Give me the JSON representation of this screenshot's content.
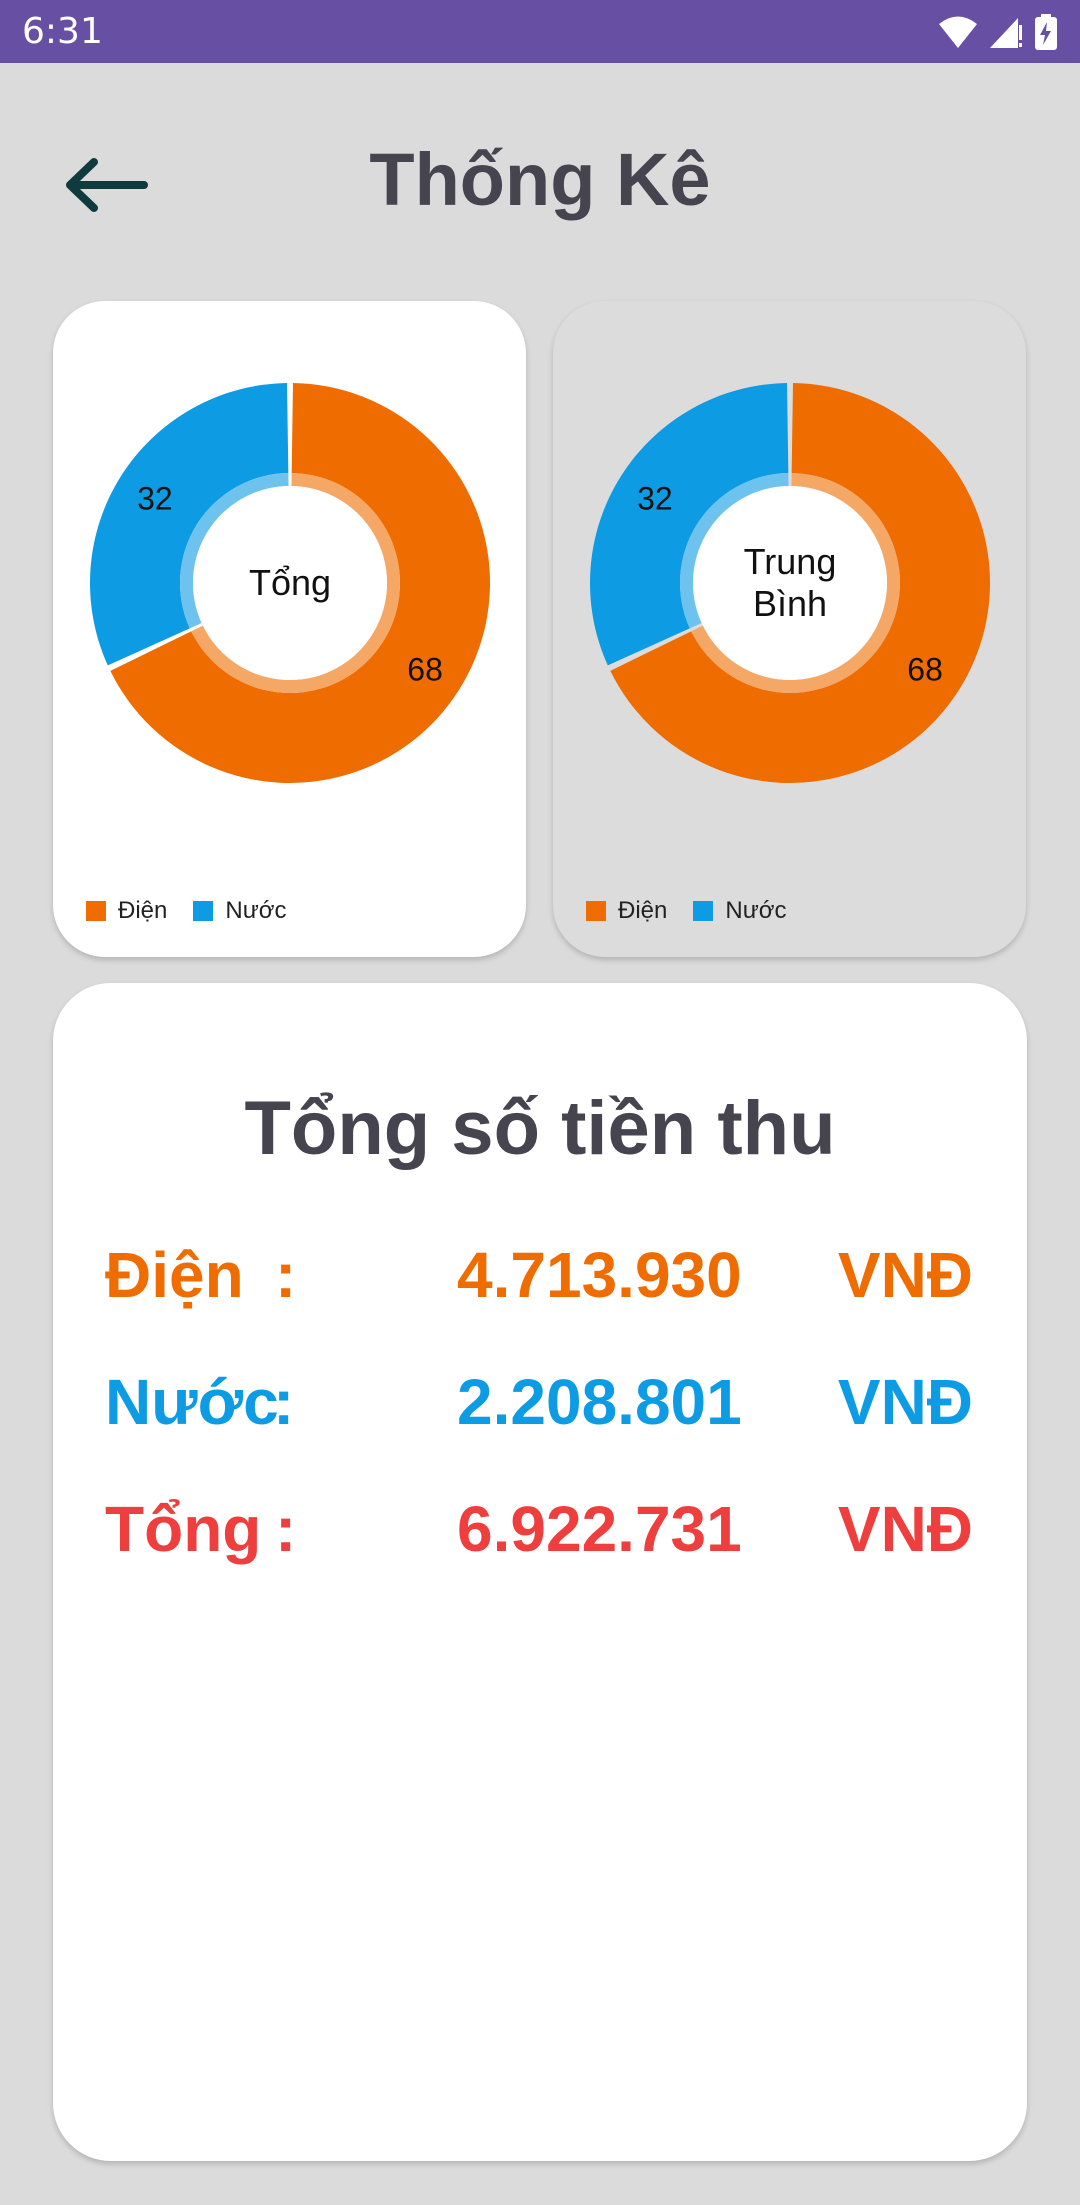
{
  "status_bar": {
    "time": "6:31",
    "icons": [
      "wifi-icon",
      "signal-icon",
      "battery-charging-icon"
    ]
  },
  "header": {
    "title": "Thống Kê",
    "back_icon": "arrow-left-icon"
  },
  "colors": {
    "status_bar": "#6750a4",
    "background": "#dbdbdb",
    "dien": "#ef6c00",
    "nuoc": "#0d9be3",
    "tong": "#ee3e3e",
    "title": "#45444f"
  },
  "chart_data": [
    {
      "type": "pie",
      "center_label": "Tổng",
      "categories": [
        "Điện",
        "Nước"
      ],
      "values": [
        68,
        32
      ],
      "colors": [
        "#ef6c00",
        "#0d9be3"
      ],
      "legend": [
        "Điện",
        "Nước"
      ],
      "legend_position": "bottom-left"
    },
    {
      "type": "pie",
      "center_label": "Trung\nBình",
      "center_lines": [
        "Trung",
        "Bình"
      ],
      "categories": [
        "Điện",
        "Nước"
      ],
      "values": [
        68,
        32
      ],
      "colors": [
        "#ef6c00",
        "#0d9be3"
      ],
      "legend": [
        "Điện",
        "Nước"
      ],
      "legend_position": "bottom-left"
    }
  ],
  "summary": {
    "title": "Tổng số tiền thu",
    "rows": [
      {
        "label": "Điện",
        "colon": ":",
        "amount": "4.713.930",
        "currency": "VNĐ"
      },
      {
        "label": "Nước",
        "colon": ":",
        "amount": "2.208.801",
        "currency": "VNĐ"
      },
      {
        "label": "Tổng",
        "colon": ":",
        "amount": "6.922.731",
        "currency": "VNĐ"
      }
    ]
  }
}
